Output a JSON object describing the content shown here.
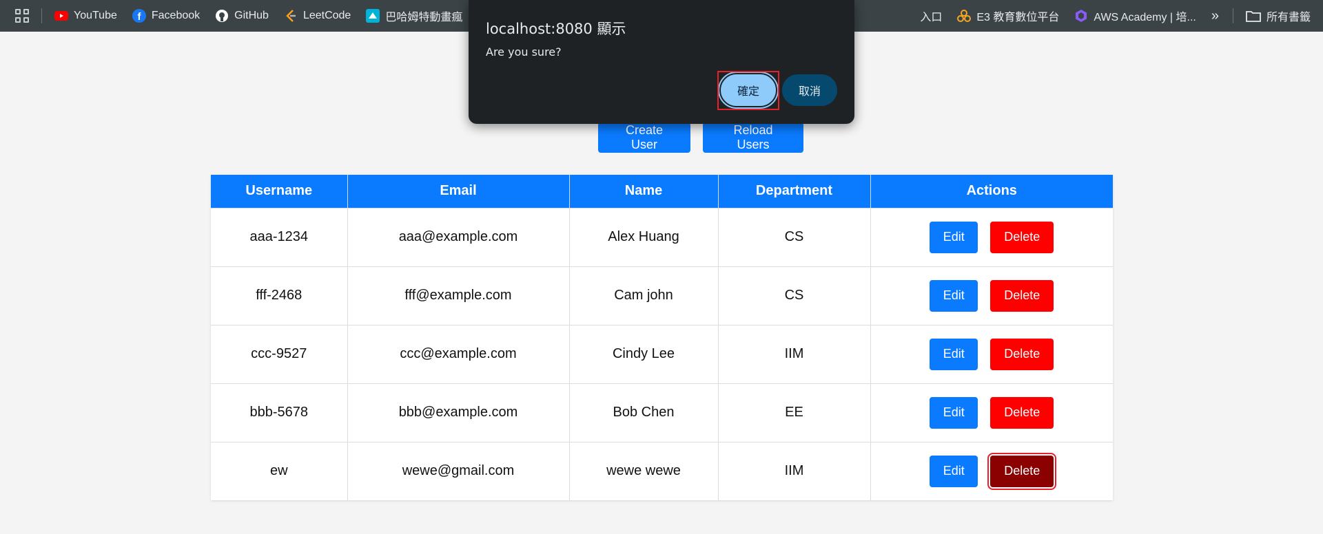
{
  "bookmarks": {
    "items": [
      {
        "label": "YouTube",
        "icon": "youtube-icon",
        "color": "#ff0000"
      },
      {
        "label": "Facebook",
        "icon": "facebook-icon",
        "color": "#1877f2"
      },
      {
        "label": "GitHub",
        "icon": "github-icon",
        "color": "#ffffff"
      },
      {
        "label": "LeetCode",
        "icon": "leetcode-icon",
        "color": "#ffa116"
      },
      {
        "label": "巴哈姆特動畫瘋",
        "icon": "bahamut-icon",
        "color": "#00b4d8"
      }
    ],
    "right_items": [
      {
        "label": "入口"
      },
      {
        "label": "E3 教育數位平台",
        "icon": "e3-icon",
        "color": "#f5a623"
      },
      {
        "label": "AWS Academy | 培...",
        "icon": "aws-academy-icon",
        "color": "#8a5cf6"
      }
    ],
    "more_label": "»",
    "all_bookmarks_label": "所有書籤"
  },
  "toolbar": {
    "create_label": "Create User",
    "reload_label": "Reload Users"
  },
  "table": {
    "headers": [
      "Username",
      "Email",
      "Name",
      "Department",
      "Actions"
    ],
    "rows": [
      {
        "username": "aaa-1234",
        "email": "aaa@example.com",
        "name": "Alex Huang",
        "department": "CS"
      },
      {
        "username": "fff-2468",
        "email": "fff@example.com",
        "name": "Cam john",
        "department": "CS"
      },
      {
        "username": "ccc-9527",
        "email": "ccc@example.com",
        "name": "Cindy Lee",
        "department": "IIM"
      },
      {
        "username": "bbb-5678",
        "email": "bbb@example.com",
        "name": "Bob Chen",
        "department": "EE"
      },
      {
        "username": "ew",
        "email": "wewe@gmail.com",
        "name": "wewe wewe",
        "department": "IIM"
      }
    ],
    "edit_label": "Edit",
    "delete_label": "Delete"
  },
  "dialog": {
    "title": "localhost:8080 顯示",
    "message": "Are you sure?",
    "ok_label": "確定",
    "cancel_label": "取消"
  },
  "colors": {
    "primary": "#0a7bff",
    "danger": "#fe0000",
    "danger_active": "#8b0000",
    "highlight": "#e8202a"
  }
}
